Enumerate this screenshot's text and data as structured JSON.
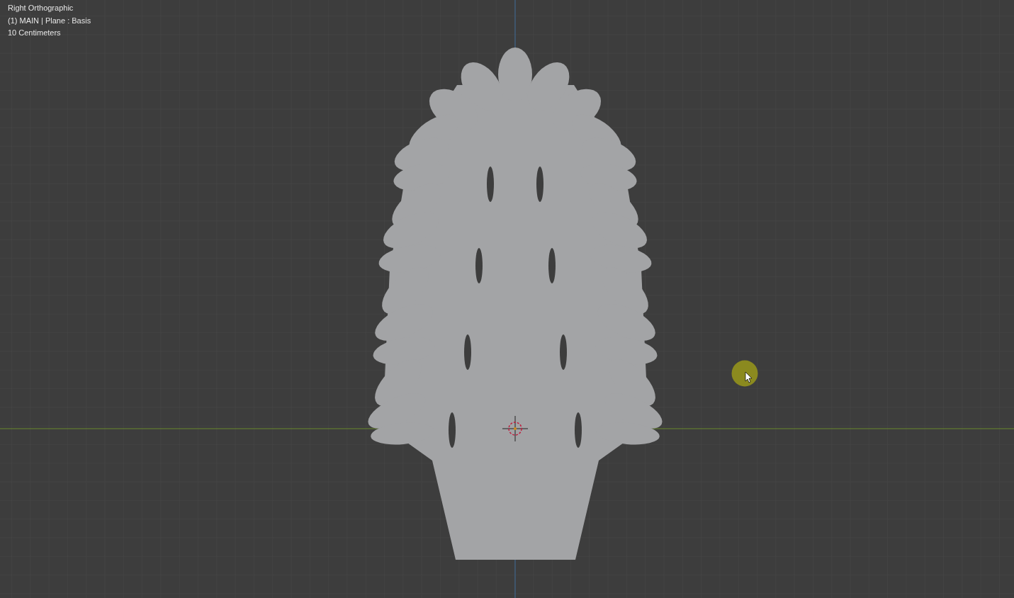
{
  "viewport": {
    "overlay_lines": [
      "Right Orthographic",
      "(1) MAIN | Plane : Basis",
      "10 Centimeters"
    ]
  }
}
